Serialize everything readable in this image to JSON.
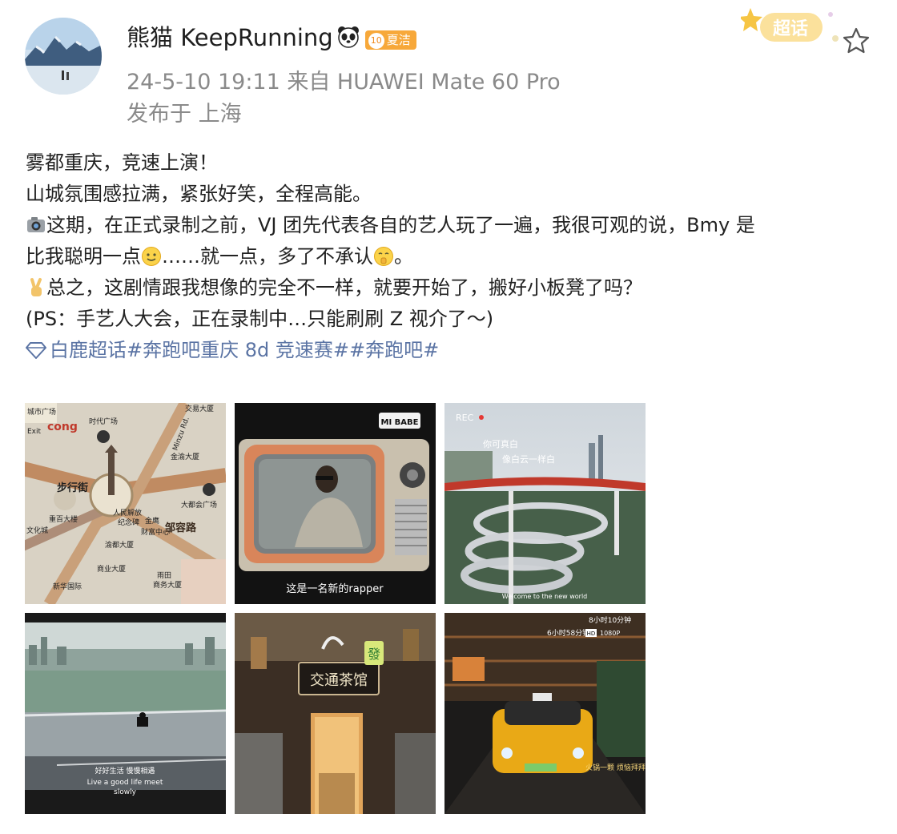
{
  "author": {
    "name": "熊猫 KeepRunning",
    "badge_level": "10",
    "badge_label": "夏洁",
    "avatar_icon": "mountain-lake-avatar"
  },
  "meta": {
    "time_source": "24-5-10 19:11  来自 HUAWEI Mate 60 Pro",
    "location": "发布于 上海"
  },
  "header": {
    "chaohua_label": "超话",
    "favorite_icon": "star-outline-icon"
  },
  "post": {
    "line1": "雾都重庆，竞速上演！",
    "line2": "山城氛围感拉满，紧张好笑，全程高能。",
    "line3": "这期，在正式录制之前，VJ 团先代表各自的艺人玩了一遍，我很可观的说，Bmy 是",
    "line4_a": "比我聪明一点",
    "line4_b": "……就一点，多了不承认",
    "line4_c": "。",
    "line5": "总之，这剧情跟我想像的完全不一样，就要开始了，搬好小板凳了吗？",
    "line6": "(PS：手艺人大会，正在录制中…只能刷刷 Z 视介了～)",
    "tags": "白鹿超话#奔跑吧重庆 8d 竞速赛##奔跑吧#"
  },
  "images": {
    "img1": {
      "name": "chongqing-map",
      "labels": [
        "城市广场",
        "时代广场",
        "交易大厦",
        "Minzu Rd.",
        "金渝大厦",
        "人民解放",
        "纪念碑",
        "步行街",
        "大都会广场",
        "金鹰",
        "财富中心",
        "重百大楼",
        "文化城",
        "渝都大厦",
        "商业大厦",
        "新华国际",
        "雨田",
        "商务大厦",
        "邹容路",
        "cong",
        "Exit"
      ]
    },
    "img2": {
      "name": "retro-tv",
      "caption": "这是一名新的rapper",
      "sign": "MI BABE"
    },
    "img3": {
      "name": "red-bridge-interchange",
      "rec": "REC",
      "text1": "你可真白",
      "text2": "像白云一样白",
      "bottom": "Welcome to the new world"
    },
    "img4": {
      "name": "river-bridge-rider",
      "sub1": "好好生活 慢慢相遇",
      "sub2": "Live a good life meet",
      "sub3": "slowly"
    },
    "img5": {
      "name": "jiaotong-teahouse",
      "sign": "交通茶馆",
      "tile": "發"
    },
    "img6": {
      "name": "yellow-taxi-tunnel",
      "time1": "8小时10分钟",
      "time2": "6小时58分钟",
      "hd": "HD",
      "res": "1080P",
      "caption": "火锅一颗 烦恼拜拜"
    }
  }
}
